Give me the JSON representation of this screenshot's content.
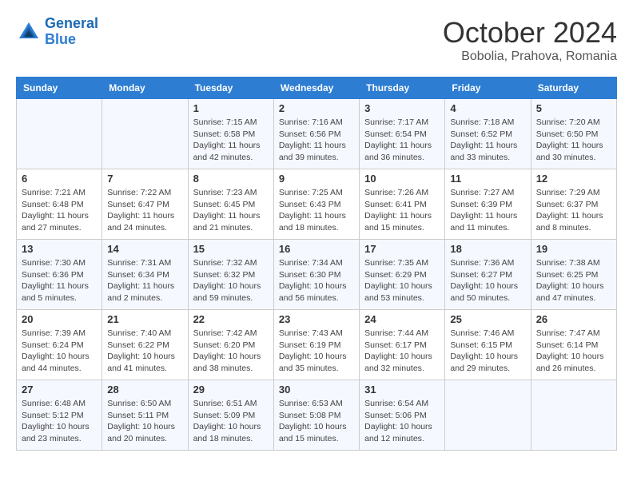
{
  "header": {
    "logo_line1": "General",
    "logo_line2": "Blue",
    "month": "October 2024",
    "location": "Bobolia, Prahova, Romania"
  },
  "columns": [
    "Sunday",
    "Monday",
    "Tuesday",
    "Wednesday",
    "Thursday",
    "Friday",
    "Saturday"
  ],
  "weeks": [
    [
      {
        "day": "",
        "detail": ""
      },
      {
        "day": "",
        "detail": ""
      },
      {
        "day": "1",
        "detail": "Sunrise: 7:15 AM\nSunset: 6:58 PM\nDaylight: 11 hours and 42 minutes."
      },
      {
        "day": "2",
        "detail": "Sunrise: 7:16 AM\nSunset: 6:56 PM\nDaylight: 11 hours and 39 minutes."
      },
      {
        "day": "3",
        "detail": "Sunrise: 7:17 AM\nSunset: 6:54 PM\nDaylight: 11 hours and 36 minutes."
      },
      {
        "day": "4",
        "detail": "Sunrise: 7:18 AM\nSunset: 6:52 PM\nDaylight: 11 hours and 33 minutes."
      },
      {
        "day": "5",
        "detail": "Sunrise: 7:20 AM\nSunset: 6:50 PM\nDaylight: 11 hours and 30 minutes."
      }
    ],
    [
      {
        "day": "6",
        "detail": "Sunrise: 7:21 AM\nSunset: 6:48 PM\nDaylight: 11 hours and 27 minutes."
      },
      {
        "day": "7",
        "detail": "Sunrise: 7:22 AM\nSunset: 6:47 PM\nDaylight: 11 hours and 24 minutes."
      },
      {
        "day": "8",
        "detail": "Sunrise: 7:23 AM\nSunset: 6:45 PM\nDaylight: 11 hours and 21 minutes."
      },
      {
        "day": "9",
        "detail": "Sunrise: 7:25 AM\nSunset: 6:43 PM\nDaylight: 11 hours and 18 minutes."
      },
      {
        "day": "10",
        "detail": "Sunrise: 7:26 AM\nSunset: 6:41 PM\nDaylight: 11 hours and 15 minutes."
      },
      {
        "day": "11",
        "detail": "Sunrise: 7:27 AM\nSunset: 6:39 PM\nDaylight: 11 hours and 11 minutes."
      },
      {
        "day": "12",
        "detail": "Sunrise: 7:29 AM\nSunset: 6:37 PM\nDaylight: 11 hours and 8 minutes."
      }
    ],
    [
      {
        "day": "13",
        "detail": "Sunrise: 7:30 AM\nSunset: 6:36 PM\nDaylight: 11 hours and 5 minutes."
      },
      {
        "day": "14",
        "detail": "Sunrise: 7:31 AM\nSunset: 6:34 PM\nDaylight: 11 hours and 2 minutes."
      },
      {
        "day": "15",
        "detail": "Sunrise: 7:32 AM\nSunset: 6:32 PM\nDaylight: 10 hours and 59 minutes."
      },
      {
        "day": "16",
        "detail": "Sunrise: 7:34 AM\nSunset: 6:30 PM\nDaylight: 10 hours and 56 minutes."
      },
      {
        "day": "17",
        "detail": "Sunrise: 7:35 AM\nSunset: 6:29 PM\nDaylight: 10 hours and 53 minutes."
      },
      {
        "day": "18",
        "detail": "Sunrise: 7:36 AM\nSunset: 6:27 PM\nDaylight: 10 hours and 50 minutes."
      },
      {
        "day": "19",
        "detail": "Sunrise: 7:38 AM\nSunset: 6:25 PM\nDaylight: 10 hours and 47 minutes."
      }
    ],
    [
      {
        "day": "20",
        "detail": "Sunrise: 7:39 AM\nSunset: 6:24 PM\nDaylight: 10 hours and 44 minutes."
      },
      {
        "day": "21",
        "detail": "Sunrise: 7:40 AM\nSunset: 6:22 PM\nDaylight: 10 hours and 41 minutes."
      },
      {
        "day": "22",
        "detail": "Sunrise: 7:42 AM\nSunset: 6:20 PM\nDaylight: 10 hours and 38 minutes."
      },
      {
        "day": "23",
        "detail": "Sunrise: 7:43 AM\nSunset: 6:19 PM\nDaylight: 10 hours and 35 minutes."
      },
      {
        "day": "24",
        "detail": "Sunrise: 7:44 AM\nSunset: 6:17 PM\nDaylight: 10 hours and 32 minutes."
      },
      {
        "day": "25",
        "detail": "Sunrise: 7:46 AM\nSunset: 6:15 PM\nDaylight: 10 hours and 29 minutes."
      },
      {
        "day": "26",
        "detail": "Sunrise: 7:47 AM\nSunset: 6:14 PM\nDaylight: 10 hours and 26 minutes."
      }
    ],
    [
      {
        "day": "27",
        "detail": "Sunrise: 6:48 AM\nSunset: 5:12 PM\nDaylight: 10 hours and 23 minutes."
      },
      {
        "day": "28",
        "detail": "Sunrise: 6:50 AM\nSunset: 5:11 PM\nDaylight: 10 hours and 20 minutes."
      },
      {
        "day": "29",
        "detail": "Sunrise: 6:51 AM\nSunset: 5:09 PM\nDaylight: 10 hours and 18 minutes."
      },
      {
        "day": "30",
        "detail": "Sunrise: 6:53 AM\nSunset: 5:08 PM\nDaylight: 10 hours and 15 minutes."
      },
      {
        "day": "31",
        "detail": "Sunrise: 6:54 AM\nSunset: 5:06 PM\nDaylight: 10 hours and 12 minutes."
      },
      {
        "day": "",
        "detail": ""
      },
      {
        "day": "",
        "detail": ""
      }
    ]
  ]
}
